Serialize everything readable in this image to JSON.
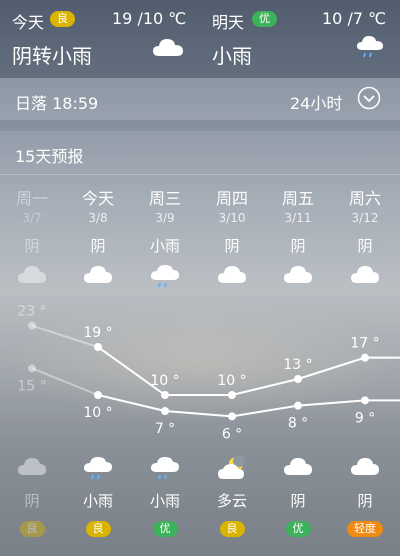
{
  "today": {
    "label": "今天",
    "aqi": "良",
    "aqi_color": "#d9b400",
    "temps": "19 /10 ℃",
    "condition": "阴转小雨",
    "icon": "cloud-icon"
  },
  "tomorrow": {
    "label": "明天",
    "aqi": "优",
    "aqi_color": "#3cb35a",
    "temps": "10 /7 ℃",
    "condition": "小雨",
    "icon": "rain-cloud-icon"
  },
  "sunset": {
    "text": "日落 18:59"
  },
  "hourly_toggle": {
    "label": "24小时"
  },
  "forecast": {
    "title": "15天预报",
    "days": [
      {
        "weekday": "周一",
        "date": "3/7",
        "day_cond": "阴",
        "day_icon": "cloud-icon",
        "high": "23 °",
        "low": "15 °",
        "night_icon": "cloud-icon",
        "night_cond": "阴",
        "aqi": "良",
        "aqi_color": "#d9b400",
        "past": true
      },
      {
        "weekday": "今天",
        "date": "3/8",
        "day_cond": "阴",
        "day_icon": "cloud-icon",
        "high": "19 °",
        "low": "10 °",
        "night_icon": "rain-cloud-icon",
        "night_cond": "小雨",
        "aqi": "良",
        "aqi_color": "#d9b400",
        "past": false
      },
      {
        "weekday": "周三",
        "date": "3/9",
        "day_cond": "小雨",
        "day_icon": "rain-cloud-icon",
        "high": "10 °",
        "low": "7 °",
        "night_icon": "rain-cloud-icon",
        "night_cond": "小雨",
        "aqi": "优",
        "aqi_color": "#3cb35a",
        "past": false
      },
      {
        "weekday": "周四",
        "date": "3/10",
        "day_cond": "阴",
        "day_icon": "cloud-icon",
        "high": "10 °",
        "low": "6 °",
        "night_icon": "moon-cloud-icon",
        "night_cond": "多云",
        "aqi": "良",
        "aqi_color": "#d9b400",
        "past": false
      },
      {
        "weekday": "周五",
        "date": "3/11",
        "day_cond": "阴",
        "day_icon": "cloud-icon",
        "high": "13 °",
        "low": "8 °",
        "night_icon": "cloud-icon",
        "night_cond": "阴",
        "aqi": "优",
        "aqi_color": "#3cb35a",
        "past": false
      },
      {
        "weekday": "周六",
        "date": "3/12",
        "day_cond": "阴",
        "day_icon": "cloud-icon",
        "high": "17 °",
        "low": "9 °",
        "night_icon": "cloud-icon",
        "night_cond": "阴",
        "aqi": "轻度",
        "aqi_color": "#f08a12",
        "past": false
      }
    ],
    "highs": [
      23,
      19,
      10,
      10,
      13,
      17
    ],
    "lows": [
      15,
      10,
      7,
      6,
      8,
      9
    ]
  }
}
